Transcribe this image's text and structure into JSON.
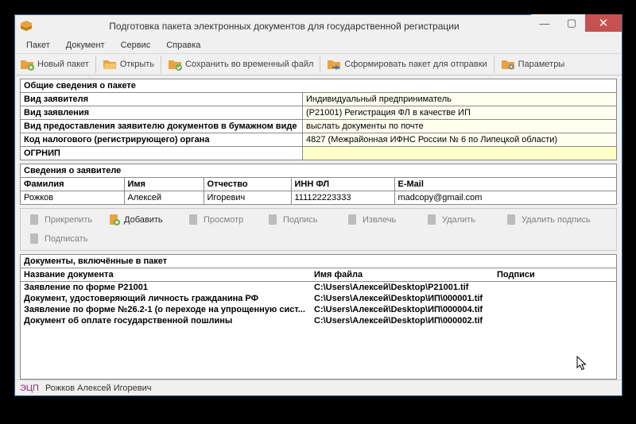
{
  "title": "Подготовка пакета электронных документов для государственной регистрации",
  "menu": {
    "paket": "Пакет",
    "dokument": "Документ",
    "servis": "Сервис",
    "spravka": "Справка"
  },
  "toolbar": {
    "new": "Новый пакет",
    "open": "Открыть",
    "saveTemp": "Сохранить во временный файл",
    "form": "Сформировать пакет для отправки",
    "params": "Параметры"
  },
  "general": {
    "header": "Общие сведения о пакете",
    "vid_zayavitelya_l": "Вид заявителя",
    "vid_zayavitelya_v": "Индивидуальный предприниматель",
    "vid_zayavleniya_l": "Вид заявления",
    "vid_zayavleniya_v": "(Р21001) Регистрация ФЛ в качестве ИП",
    "vid_predost_l": "Вид предоставления заявителю документов в бумажном виде",
    "vid_predost_v": "выслать документы по почте",
    "kod_nalog_l": "Код налогового (регистрирующего) органа",
    "kod_nalog_v": "4827 (Межрайонная ИФНС России № 6 по Липецкой области)",
    "ogrnip_l": "ОГРНИП",
    "ogrnip_v": ""
  },
  "applicant": {
    "header": "Сведения о заявителе",
    "h_f": "Фамилия",
    "h_i": "Имя",
    "h_o": "Отчество",
    "h_inn": "ИНН ФЛ",
    "h_email": "E-Mail",
    "f": "Рожков",
    "i": "Алексей",
    "o": "Игоревич",
    "inn": "111122223333",
    "email": "madcopy@gmail.com"
  },
  "actions": {
    "attach": "Прикрепить",
    "add": "Добавить",
    "view": "Просмотр",
    "sign": "Подпись",
    "extract": "Извлечь",
    "delete": "Удалить",
    "delSign": "Удалить подпись",
    "signIt": "Подписать"
  },
  "doclist": {
    "header": "Документы, включённые в пакет",
    "h_name": "Название документа",
    "h_file": "Имя файла",
    "h_sign": "Подписи",
    "rows": [
      {
        "name": "Заявление по форме Р21001",
        "file": "C:\\Users\\Алексей\\Desktop\\Р21001.tif"
      },
      {
        "name": "Документ, удостоверяющий личность гражданина РФ",
        "file": "C:\\Users\\Алексей\\Desktop\\ИП\\000001.tif"
      },
      {
        "name": "Заявление по форме №26.2-1 (о переходе на упрощенную сист...",
        "file": "C:\\Users\\Алексей\\Desktop\\ИП\\000004.tif"
      },
      {
        "name": "Документ об оплате государственной пошлины",
        "file": "C:\\Users\\Алексей\\Desktop\\ИП\\000002.tif"
      }
    ]
  },
  "status": {
    "ecp": "ЭЦП",
    "user": "Рожков Алексей Игоревич"
  }
}
